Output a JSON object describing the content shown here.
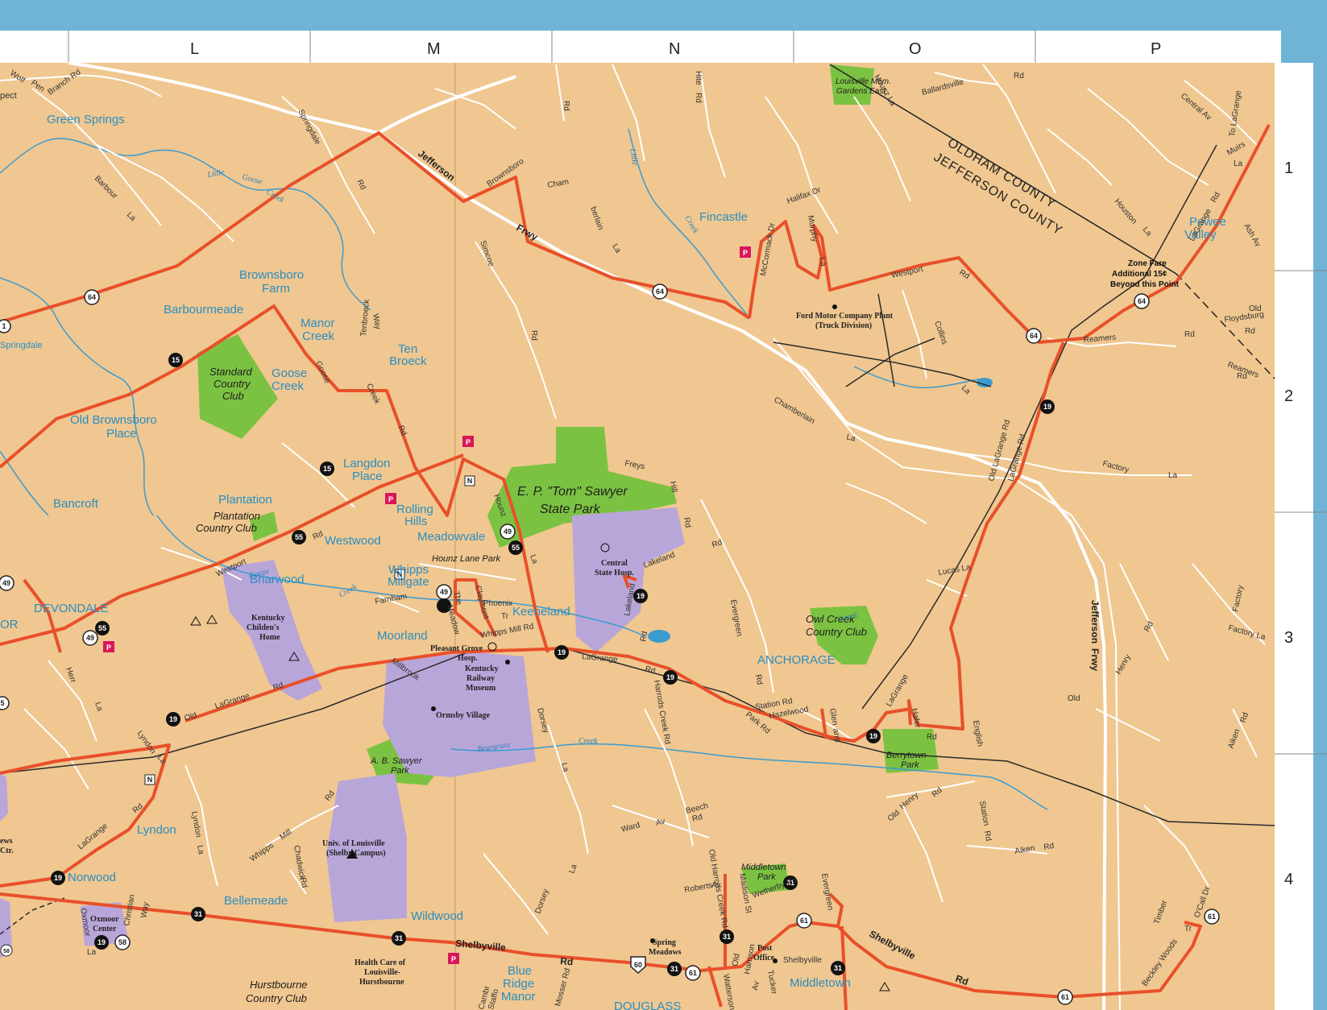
{
  "grid": {
    "columns": [
      "L",
      "M",
      "N",
      "O",
      "P"
    ],
    "rows": [
      "1",
      "2",
      "3",
      "4"
    ]
  },
  "colors": {
    "land": "#f0c790",
    "border": "#6fb4d6",
    "route": "#e8502a",
    "park": "#7cc242",
    "institution": "#b9a6d9",
    "water": "#3a9bd0",
    "street": "#ffffff",
    "railroad": "#2b2b2b"
  },
  "places": {
    "green_springs": "Green Springs",
    "brownsboro_farm_1": "Brownsboro",
    "brownsboro_farm_2": "Farm",
    "barbourmeade": "Barbourmeade",
    "manor_creek_1": "Manor",
    "manor_creek_2": "Creek",
    "ten_broeck_1": "Ten",
    "ten_broeck_2": "Broeck",
    "goose_creek_1": "Goose",
    "goose_creek_2": "Creek",
    "old_brownsboro_1": "Old Brownsboro",
    "old_brownsboro_2": "Place",
    "langdon_1": "Langdon",
    "langdon_2": "Place",
    "bancroft": "Bancroft",
    "plantation": "Plantation",
    "rolling_hills_1": "Rolling",
    "rolling_hills_2": "Hills",
    "westwood": "Westwood",
    "meadowvale": "Meadowvale",
    "whipps_millgate_1": "Whipps",
    "whipps_millgate_2": "Millgate",
    "briarwood": "Briarwood",
    "devondale": "DEVONDALE",
    "or": "OR",
    "keeneland": "Keeneland",
    "moorland": "Moorland",
    "fincastle": "Fincastle",
    "pewee_valley_1": "Pewee",
    "pewee_valley_2": "Valley",
    "anchorage": "ANCHORAGE",
    "lyndon": "Lyndon",
    "norwood": "Norwood",
    "bellemeade": "Bellemeade",
    "wildwood": "Wildwood",
    "middletown": "Middletown",
    "blue_ridge_1": "Blue",
    "blue_ridge_2": "Ridge",
    "blue_ridge_3": "Manor",
    "douglass": "DOUGLASS",
    "springdale": "Springdale",
    "spect": "pect"
  },
  "parks": {
    "standard_cc_1": "Standard",
    "standard_cc_2": "Country",
    "standard_cc_3": "Club",
    "plantation_cc_1": "Plantation",
    "plantation_cc_2": "Country Club",
    "sawyer_1": "E. P. \"Tom\" Sawyer",
    "sawyer_2": "State Park",
    "hounz_lane_park": "Hounz Lane Park",
    "owl_creek_1": "Owl Creek",
    "owl_creek_2": "Country Club",
    "berrytown_1": "Berrytown",
    "berrytown_2": "Park",
    "ab_sawyer_1": "A. B. Sawyer",
    "ab_sawyer_2": "Park",
    "middletown_park_1": "Middletown",
    "middletown_park_2": "Park",
    "louisville_mem_1": "Louisville Mem.",
    "louisville_mem_2": "Gardens East",
    "hurstbourne_cc_1": "Hurstbourne",
    "hurstbourne_cc_2": "Country Club"
  },
  "pois": {
    "ford_1": "Ford Motor Company Plant",
    "ford_2": "(Truck Division)",
    "central_state_1": "Central",
    "central_state_2": "State Hosp.",
    "kentucky_childrens_1": "Kentucky",
    "kentucky_childrens_2": "Childen's",
    "kentucky_childrens_3": "Home",
    "pleasant_grove_1": "Pleasant Grove",
    "pleasant_grove_2": "Hosp.",
    "kentucky_railway_1": "Kentucky",
    "kentucky_railway_2": "Railway",
    "kentucky_railway_3": "Museum",
    "ormsby_village": "Ormsby Village",
    "univ_louisville_1": "Univ. of Louisville",
    "univ_louisville_2": "(Shelby Campus)",
    "oxmoor_1": "Oxmoor",
    "oxmoor_2": "Center",
    "health_care_1": "Health Care of",
    "health_care_2": "Louisville-",
    "health_care_3": "Hurstbourne",
    "spring_meadows_1": "Spring",
    "spring_meadows_2": "Meadows",
    "post_office_1": "Post",
    "post_office_2": "Office",
    "news_1": "ews",
    "news_2": "Ctr."
  },
  "counties": {
    "oldham": "OLDHAM COUNTY",
    "jefferson": "JEFFERSON COUNTY"
  },
  "notes": {
    "zone_fare_1": "Zone Fare",
    "zone_fare_2": "Additional 15¢",
    "zone_fare_3": "Beyond this Point",
    "to_lagrange": "To LaGrange"
  },
  "roads": {
    "jefferson_frwy_1": "Jefferson",
    "jefferson_frwy_2": "Frwy",
    "jefferson_frwy_v_1": "Jefferson",
    "jefferson_frwy_v_2": "Frwy",
    "shelbyville_rd_1": "Shelbyville",
    "shelbyville_rd_2": "Rd",
    "shelbyville_rd_3": "Shelbyville",
    "shelbyville_rd_4": "Rd",
    "lagrange_rd": "LaGrange",
    "lagrange_rd_2": "Rd",
    "old_lagrange_1": "Old",
    "old_lagrange_2": "LaGrange",
    "old_lagrange_3": "Rd",
    "westport_rd": "Westport",
    "westport_rd_2": "Rd",
    "westport_ne": "Westport",
    "westport_ne_2": "Rd",
    "brownsboro": "Brownsboro",
    "chamberlain_1": "Chamberlain",
    "chamberlain_2": "La",
    "chamberlain_3": "Chamberlain",
    "chamberlain_4": "La",
    "hounz_la": "Hounz La",
    "ballardsville_1": "Ballardsville",
    "ballardsville_2": "Rd",
    "springdale_rd_1": "Springdale",
    "springdale_rd_2": "Rd",
    "barbour_la_1": "Barbour",
    "barbour_la_2": "La",
    "wolf_pen_1": "Wolf",
    "wolf_pen_2": "Pen",
    "branch_rd": "Branch Rd",
    "simcoe_1": "Simcoe",
    "simcoe_2": "Rd",
    "hite_1": "Hite",
    "hite_2": "Rd",
    "rd_top": "Rd",
    "goose_creek_rd_1": "Goose",
    "goose_creek_rd_2": "Creek",
    "goose_creek_rd_3": "Rd",
    "tenbroeck_way_1": "Tenbroeck",
    "tenbroeck_way_2": "Way",
    "freys_hill_1": "Freys",
    "freys_hill_2": "Hill",
    "freys_hill_3": "Rd",
    "hounz_la_2": "Hounz",
    "hounz_la_3": "La",
    "lakeland_1": "Lakeland",
    "lakeland_2": "Lakeland",
    "lakeland_3": "Rd",
    "rd_mid": "Rd",
    "evergreen_1": "Evergreen",
    "evergreen_2": "Rd",
    "evergreen_3": "Evergreen",
    "collins_1": "Collins",
    "collins_2": "La",
    "reamers_1": "Reamers",
    "reamers_2": "Rd",
    "reamers_3": "Reamers",
    "reamers_4": "Rd",
    "factory_1": "Factory",
    "factory_2": "La",
    "factory_3": "Factory",
    "factory_4": "Factory La",
    "lucas_la": "Lucas La",
    "old_lagrange_rd": "Old LaGrange Rd",
    "lagrange_rd_v": "LaGrange Rd",
    "lagrange_rd_ne": "LaGrange",
    "lagrange_rd_ne_2": "Rd",
    "central_av": "Central Av",
    "muirs_1": "Muirs",
    "muirs_2": "La",
    "houston_1": "Houston",
    "houston_2": "La",
    "ash_av": "Ash Av",
    "old_floydsburg_1": "Old",
    "old_floydsburg_2": "Floydsburg",
    "old_floydsburg_3": "Rd",
    "halifax": "Halifax Dr",
    "mccormack": "McCormack Dr",
    "murphy_1": "Murphy",
    "murphy_2": "La",
    "champ_1": "Cham",
    "champ_2": "berlain",
    "champ_3": "La",
    "henry_1": "Henry",
    "henry_2": "Rd",
    "henry_3": "Henry",
    "henry_4": "Rd",
    "old_rd": "Old",
    "aiken_1": "Aiken",
    "aiken_2": "Rd",
    "aiken_3": "Aiken",
    "aiken_4": "Rd",
    "english": "English",
    "station_1": "Station",
    "station_2": "Rd",
    "station_rd_sm": "Station Rd",
    "hazelwood": "Hazelwood",
    "park_rd": "Park Rd",
    "glenarm_1": "Glen",
    "glenarm_2": "arm",
    "lagrange_small": "LaGrange",
    "hafer_1": "Hafer",
    "hafer_2": "Rd",
    "farnham": "Farnham",
    "phoenix_1": "Phoenix",
    "phoenix_2": "Tr",
    "whipps_mill_rd": "Whipps Mill Rd",
    "the_meadow_1": "The",
    "the_meadow_2": "Meadow",
    "claymont": "Claymont",
    "millbrook": "Millbrook",
    "dorsey_1": "Dorsey",
    "dorsey_2": "La",
    "dorsey_3": "Dorsey",
    "dorsey_4": "La",
    "beargrass_1": "Beargrass",
    "beargrass_2": "Creek",
    "harrods_1": "Harrods Creek Rd",
    "harrods_2": "Old Harrods Creek Rd",
    "ward_av": "Ward",
    "ward_av_2": "Av",
    "beech_1": "Beech",
    "beech_2": "Rd",
    "roberts_1": "Roberts",
    "roberts_2": "Av",
    "madison": "Madison St",
    "wetherby": "Wetherby Rd",
    "tucker": "Tucker",
    "old_harrison_1": "Old",
    "old_harrison_2": "Harrison",
    "old_harrison_3": "Av",
    "watterson": "Watterson",
    "timber_1": "Timber",
    "timber_2": "Tr",
    "beckley": "Beckley Woods",
    "ocall_dr": "O'Call Dr",
    "herr_1": "Herr",
    "herr_2": "La",
    "lyndon_la_1": "Lyndon",
    "lyndon_la_2": "La",
    "lyndon_la_3": "Lyndon",
    "lyndon_la_4": "La",
    "lagrange_sw_1": "LaGrange",
    "lagrange_sw_2": "Rd",
    "whipps_mill_1": "Whipps",
    "whipps_mill_2": "Mill",
    "whipps_mill_3": "Rd",
    "chadwick_1": "Chadwick",
    "chadwick_2": "Rd",
    "oxmoor_la_1": "Oxmoor",
    "oxmoor_la_2": "La",
    "christian_1": "Christian",
    "christian_2": "Way",
    "mosser": "Mosser Rd",
    "cambridge": "Cambr",
    "stafford": "Staffo",
    "shelbyville_small": "Shelbyville",
    "creek_small": "Creek",
    "little_goose_1": "Little",
    "little_goose_2": "Goose",
    "little_goose_3": "Creek",
    "goose_creek_lbl_1": "Goose",
    "goose_creek_lbl_2": "Creek",
    "little_creek_1": "Little",
    "little_creek_2": "Creek",
    "old_henry_1": "Old",
    "old_henry_2": "Henry",
    "old_henry_3": "Rd"
  },
  "route_shields": {
    "r64a": "64",
    "r64b": "64",
    "r64c": "64",
    "r64d": "64",
    "r15a": "15",
    "r15b": "15",
    "r55a": "55",
    "r55b": "55",
    "r55c": "55",
    "r49a": "49",
    "r49b": "49",
    "r49c": "49",
    "r49d": "49",
    "r19a": "19",
    "r19b": "19",
    "r19c": "19",
    "r19d": "19",
    "r19e": "19",
    "r19f": "19",
    "r19g": "19",
    "r19h": "19",
    "r31a": "31",
    "r31b": "31",
    "r31c": "31",
    "r31d": "31",
    "r31e": "31",
    "r31f": "31",
    "r61a": "61",
    "r61b": "61",
    "r61c": "61",
    "r61d": "61",
    "r58": "58",
    "r58b": "58",
    "us60": "60",
    "parking": "P",
    "nbadge": "N",
    "r1": "1",
    "r5": "5"
  }
}
